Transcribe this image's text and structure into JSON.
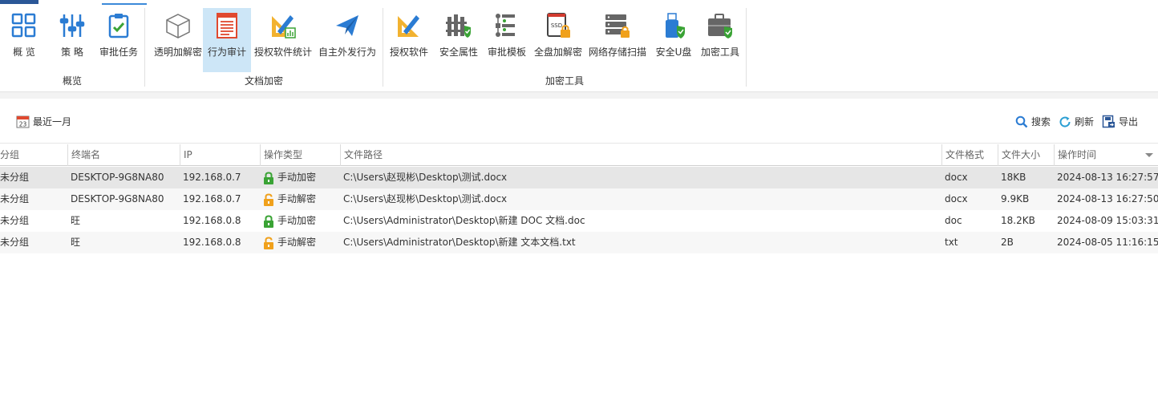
{
  "ribbon": {
    "groups": [
      {
        "label": "概览"
      },
      {
        "label": "文档加密"
      },
      {
        "label": "加密工具"
      }
    ],
    "buttons": [
      {
        "label": "概 览",
        "icon": "grid-icon"
      },
      {
        "label": "策 略",
        "icon": "sliders-icon"
      },
      {
        "label": "审批任务",
        "icon": "clipboard-check-icon"
      },
      {
        "label": "透明加解密",
        "icon": "cube-icon"
      },
      {
        "label": "行为审计",
        "icon": "document-list-icon"
      },
      {
        "label": "授权软件统计",
        "icon": "ruler-pencil-chart-icon"
      },
      {
        "label": "自主外发行为",
        "icon": "paper-plane-icon"
      },
      {
        "label": "授权软件",
        "icon": "ruler-pencil-icon"
      },
      {
        "label": "安全属性",
        "icon": "fence-shield-icon"
      },
      {
        "label": "审批模板",
        "icon": "flowchart-icon"
      },
      {
        "label": "全盘加解密",
        "icon": "ssd-lock-icon"
      },
      {
        "label": "网络存储扫描",
        "icon": "server-lock-icon"
      },
      {
        "label": "安全U盘",
        "icon": "usb-shield-icon"
      },
      {
        "label": "加密工具",
        "icon": "toolbox-shield-icon"
      }
    ]
  },
  "toolbar": {
    "date_filter": "最近一月",
    "date_icon_day": "23",
    "search": "搜索",
    "refresh": "刷新",
    "export": "导出"
  },
  "table": {
    "columns": [
      "分组",
      "终端名",
      "IP",
      "操作类型",
      "文件路径",
      "文件格式",
      "文件大小",
      "操作时间"
    ],
    "rows": [
      {
        "group": "未分组",
        "terminal": "DESKTOP-9G8NA80",
        "ip": "192.168.0.7",
        "op": "手动加密",
        "op_kind": "encrypt",
        "path": "C:\\Users\\赵现彬\\Desktop\\测试.docx",
        "format": "docx",
        "size": "18KB",
        "time": "2024-08-13 16:27:57"
      },
      {
        "group": "未分组",
        "terminal": "DESKTOP-9G8NA80",
        "ip": "192.168.0.7",
        "op": "手动解密",
        "op_kind": "decrypt",
        "path": "C:\\Users\\赵现彬\\Desktop\\测试.docx",
        "format": "docx",
        "size": "9.9KB",
        "time": "2024-08-13 16:27:50"
      },
      {
        "group": "未分组",
        "terminal": "旺",
        "ip": "192.168.0.8",
        "op": "手动加密",
        "op_kind": "encrypt",
        "path": "C:\\Users\\Administrator\\Desktop\\新建 DOC 文档.doc",
        "format": "doc",
        "size": "18.2KB",
        "time": "2024-08-09 15:03:31"
      },
      {
        "group": "未分组",
        "terminal": "旺",
        "ip": "192.168.0.8",
        "op": "手动解密",
        "op_kind": "decrypt",
        "path": "C:\\Users\\Administrator\\Desktop\\新建 文本文档.txt",
        "format": "txt",
        "size": "2B",
        "time": "2024-08-05 11:16:15"
      }
    ]
  },
  "colors": {
    "accent": "#2b7cd3",
    "selected_tab_bg": "#cde6f7",
    "lock_green": "#3aa335",
    "lock_orange": "#f0a11c"
  }
}
